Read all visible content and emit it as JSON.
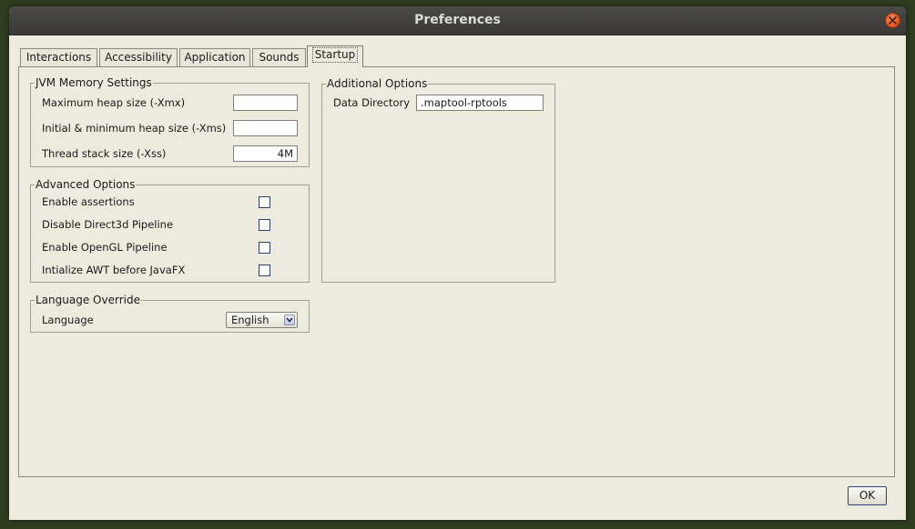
{
  "window": {
    "title": "Preferences"
  },
  "tabs": [
    {
      "label": "Interactions",
      "active": false
    },
    {
      "label": "Accessibility",
      "active": false
    },
    {
      "label": "Application",
      "active": false
    },
    {
      "label": "Sounds",
      "active": false
    },
    {
      "label": "Startup",
      "active": true
    }
  ],
  "jvm": {
    "title": "JVM Memory Settings",
    "max_heap_label": "Maximum heap size (-Xmx)",
    "max_heap_value": "",
    "min_heap_label": "Initial & minimum heap size (-Xms)",
    "min_heap_value": "",
    "stack_label": "Thread stack size (-Xss)",
    "stack_value": "4M"
  },
  "advanced": {
    "title": "Advanced Options",
    "items": [
      {
        "label": "Enable assertions",
        "checked": false
      },
      {
        "label": "Disable Direct3d Pipeline",
        "checked": false
      },
      {
        "label": "Enable OpenGL Pipeline",
        "checked": false
      },
      {
        "label": "Intialize AWT before JavaFX",
        "checked": false
      }
    ]
  },
  "language": {
    "title": "Language Override",
    "label": "Language",
    "value": "English"
  },
  "additional": {
    "title": "Additional Options",
    "data_dir_label": "Data Directory",
    "data_dir_value": ".maptool-rptools"
  },
  "buttons": {
    "ok": "OK"
  },
  "colors": {
    "title_bar": "#3f3e3a",
    "dialog_bg": "#edebde",
    "close_button": "#e2541f",
    "desktop": "#2f3d1f"
  }
}
